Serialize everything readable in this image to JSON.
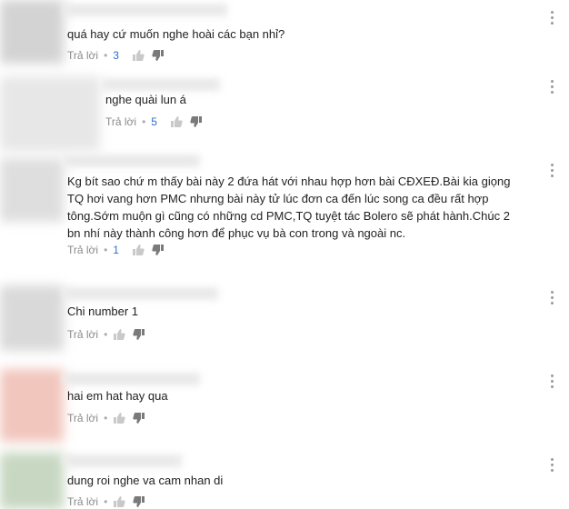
{
  "comments": [
    {
      "text": "quá hay cứ muốn nghe hoài các bạn nhỉ?",
      "reply_label": "Trả lời",
      "likes": "3"
    },
    {
      "text": "nghe quài lun á",
      "reply_label": "Trả lời",
      "likes": "5"
    },
    {
      "text": "Kg bít sao chứ m thấy bài này 2 đứa hát  với nhau hợp hơn bài CĐXEĐ.Bài kia giọng TQ hơi vang hơn PMC nhưng bài này tử lúc đơn ca đến lúc song ca đều rất hợp tông.Sớm muộn gì cũng có những cd PMC,TQ tuyệt tác Bolero sẽ phát hành.Chúc 2 bn nhí này thành công hơn để phục vụ bà con trong và ngoài nc.",
      "reply_label": "Trả lời",
      "likes": "1"
    },
    {
      "text": "Chi number 1",
      "reply_label": "Trả lời",
      "likes": ""
    },
    {
      "text": "hai em hat hay qua",
      "reply_label": "Trả lời",
      "likes": ""
    },
    {
      "text": "dung roi nghe va cam nhan di",
      "reply_label": "Trả lời",
      "likes": ""
    }
  ],
  "colors": {
    "accent": "#2b6fc7",
    "muted": "#8a8a8a"
  },
  "icons": [
    "thumbs-up-icon",
    "thumbs-down-icon",
    "more-vert-icon"
  ]
}
